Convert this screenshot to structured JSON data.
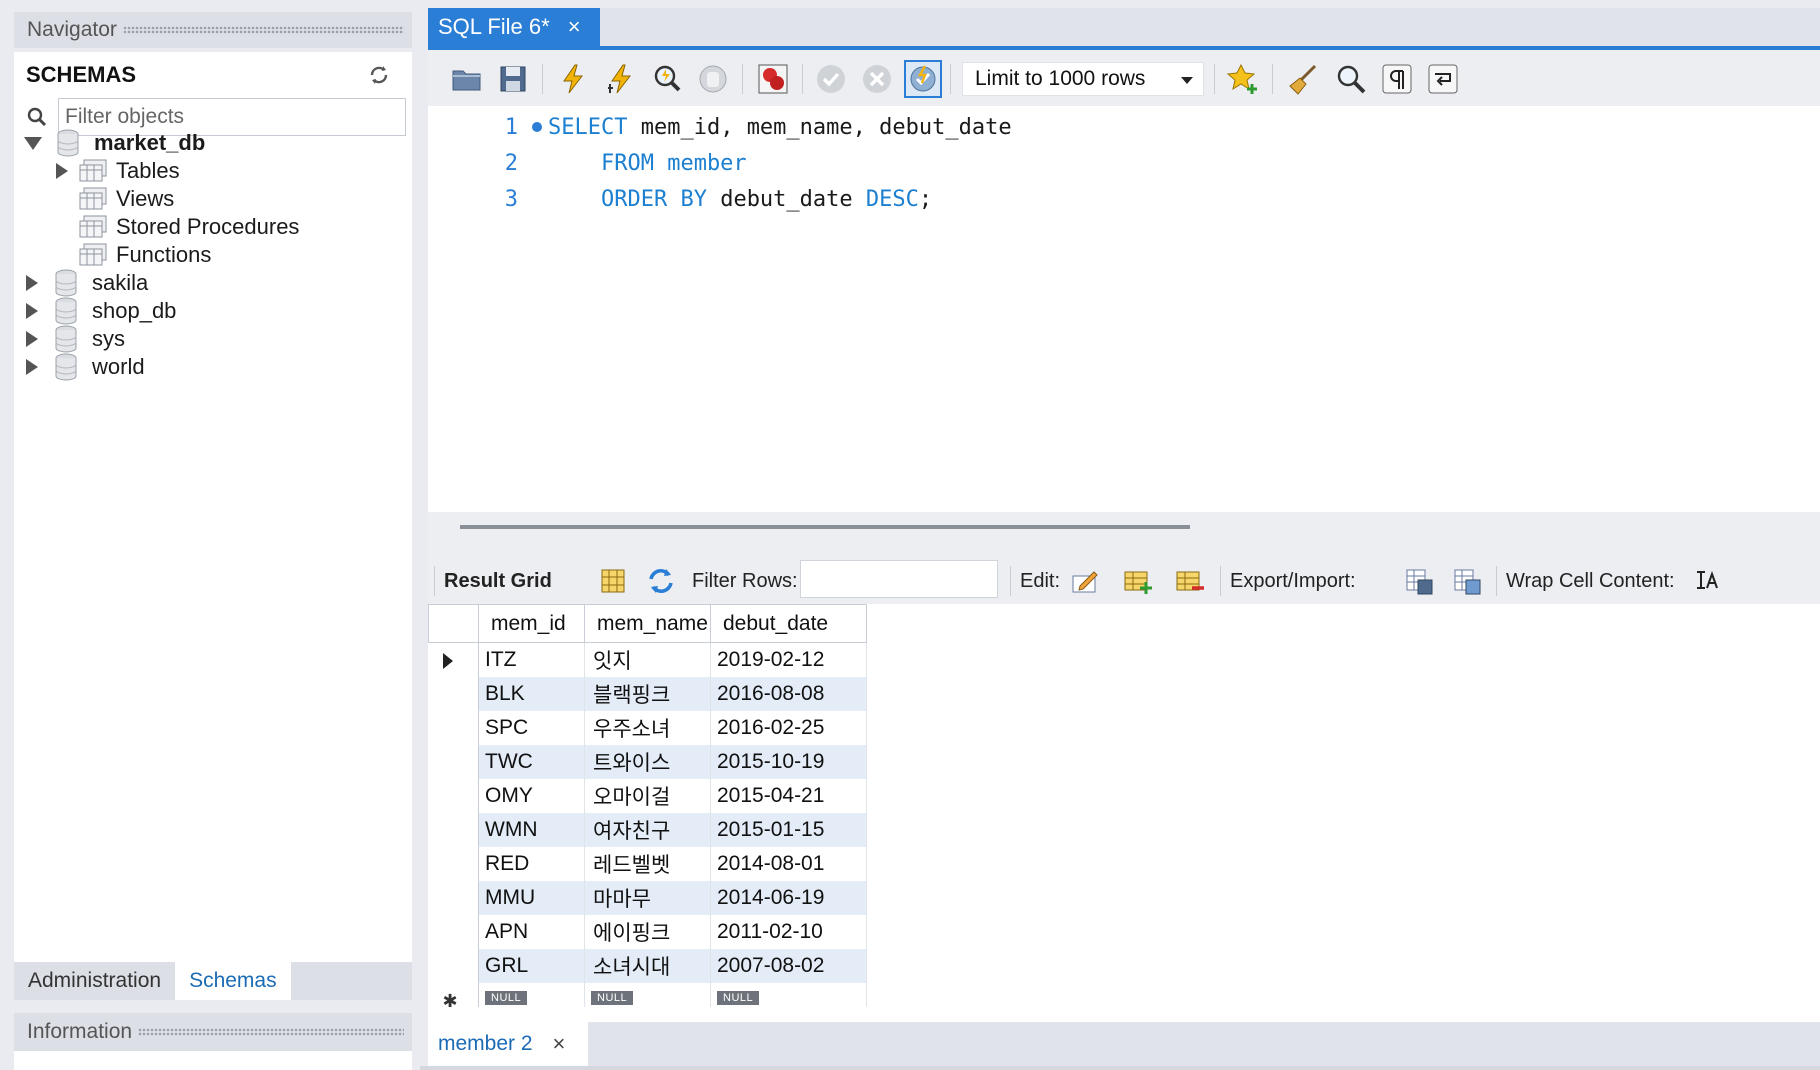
{
  "navigator": {
    "title": "Navigator",
    "schemas_title": "SCHEMAS",
    "filter_placeholder": "Filter objects",
    "tree": [
      {
        "label": "market_db",
        "expanded": true,
        "bold": true,
        "children": [
          "Tables",
          "Views",
          "Stored Procedures",
          "Functions"
        ]
      },
      {
        "label": "sakila",
        "expanded": false
      },
      {
        "label": "shop_db",
        "expanded": false
      },
      {
        "label": "sys",
        "expanded": false
      },
      {
        "label": "world",
        "expanded": false
      }
    ],
    "bottom_tabs": [
      "Administration",
      "Schemas"
    ],
    "active_bottom_tab": "Schemas",
    "info_title": "Information"
  },
  "editor": {
    "tab_label": "SQL File 6*",
    "limit_label": "Limit to 1000 rows",
    "lines": [
      {
        "num": "1",
        "tokens": [
          {
            "t": "SELECT",
            "k": true
          },
          {
            "t": " mem_id, mem_name, debut_date",
            "k": false
          }
        ]
      },
      {
        "num": "2",
        "tokens": [
          {
            "t": "    FROM member",
            "k": true
          }
        ]
      },
      {
        "num": "3",
        "tokens": [
          {
            "t": "    ORDER BY",
            "k": true
          },
          {
            "t": " debut_date ",
            "k": false
          },
          {
            "t": "DESC",
            "k": true
          },
          {
            "t": ";",
            "k": false
          }
        ]
      }
    ]
  },
  "result_toolbar": {
    "result_grid": "Result Grid",
    "filter_rows": "Filter Rows:",
    "edit": "Edit:",
    "export_import": "Export/Import:",
    "wrap_cell": "Wrap Cell Content:"
  },
  "grid": {
    "columns": [
      "mem_id",
      "mem_name",
      "debut_date"
    ],
    "rows": [
      [
        "ITZ",
        "잇지",
        "2019-02-12"
      ],
      [
        "BLK",
        "블랙핑크",
        "2016-08-08"
      ],
      [
        "SPC",
        "우주소녀",
        "2016-02-25"
      ],
      [
        "TWC",
        "트와이스",
        "2015-10-19"
      ],
      [
        "OMY",
        "오마이걸",
        "2015-04-21"
      ],
      [
        "WMN",
        "여자친구",
        "2015-01-15"
      ],
      [
        "RED",
        "레드벨벳",
        "2014-08-01"
      ],
      [
        "MMU",
        "마마무",
        "2014-06-19"
      ],
      [
        "APN",
        "에이핑크",
        "2011-02-10"
      ],
      [
        "GRL",
        "소녀시대",
        "2007-08-02"
      ]
    ],
    "null_label": "NULL"
  },
  "result_tab": {
    "label": "member 2"
  },
  "colors": {
    "accent": "#2a7ed5",
    "keyword": "#1c7fd0",
    "alt_row": "#e3ecf7"
  }
}
